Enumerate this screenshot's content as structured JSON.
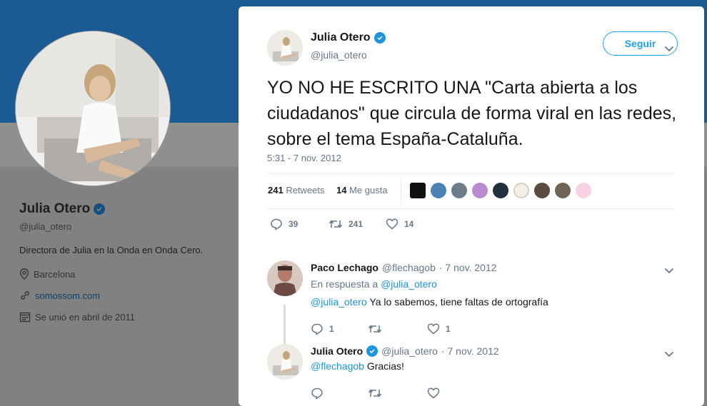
{
  "profile": {
    "name": "Julia Otero",
    "handle": "@julia_otero",
    "bio": "Directora de Julia en la Onda en Onda Cero.",
    "location": "Barcelona",
    "website": "somossom.com",
    "joined": "Se unió en abril de 2011"
  },
  "tweet": {
    "author_name": "Julia Otero",
    "author_handle": "@julia_otero",
    "follow_label": "Seguir",
    "text": "YO NO HE ESCRITO UNA \"Carta abierta a los ciudadanos\" que circula de forma viral en las redes, sobre el tema España-Cataluña.",
    "timestamp": "5:31 - 7 nov. 2012",
    "retweets_count": "241",
    "retweets_label": "Retweets",
    "likes_count": "14",
    "likes_label": "Me gusta",
    "actions": {
      "replies": "39",
      "retweets": "241",
      "likes": "14"
    }
  },
  "replies": [
    {
      "name": "Paco Lechago",
      "handle": "@flechagob",
      "date": "· 7 nov. 2012",
      "in_reply_prefix": "En respuesta a",
      "in_reply_handle": "@julia_otero",
      "mention": "@julia_otero",
      "text": " Ya lo sabemos, tiene faltas de ortografía",
      "replies": "1",
      "retweets": "",
      "likes": "1"
    },
    {
      "name": "Julia Otero",
      "handle": "@julia_otero",
      "date": "· 7 nov. 2012",
      "mention": "@flechagob",
      "text": " Gracias!",
      "replies": "",
      "retweets": "",
      "likes": ""
    }
  ],
  "colors": {
    "accent": "#1da1f2",
    "verified": "#1b95e0",
    "banner": "#1c5a93",
    "overlay_bg": "#818181"
  },
  "icons": [
    "verified-badge-icon",
    "location-pin-icon",
    "link-icon",
    "calendar-icon",
    "reply-icon",
    "retweet-icon",
    "like-icon",
    "chevron-down-icon"
  ]
}
